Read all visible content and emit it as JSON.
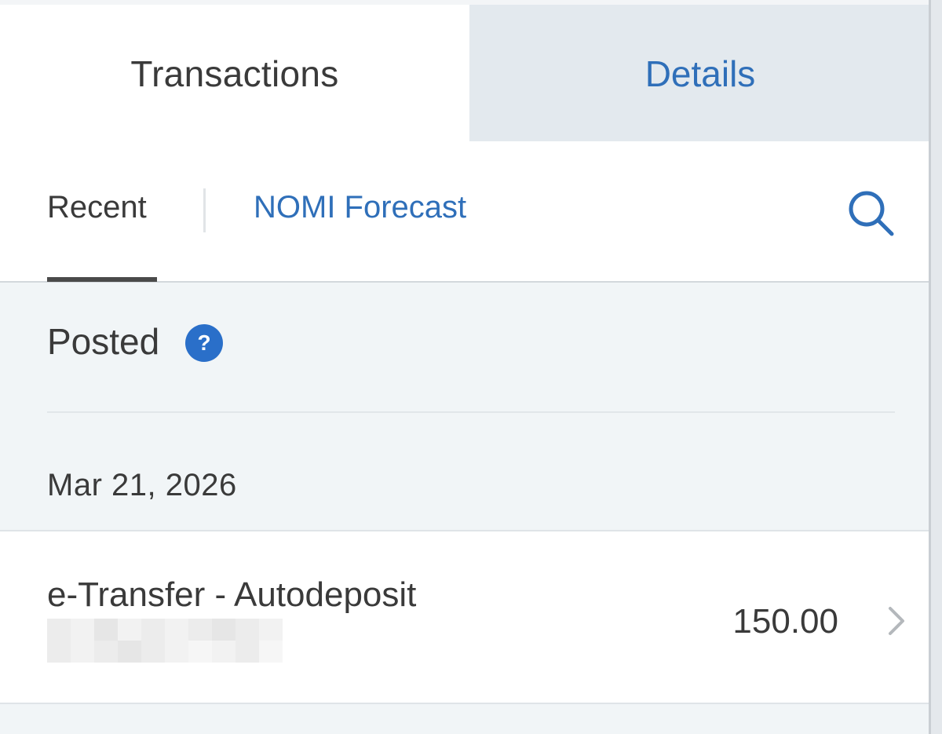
{
  "tabs": {
    "transactions_label": "Transactions",
    "details_label": "Details"
  },
  "subnav": {
    "recent_label": "Recent",
    "nomi_label": "NOMI Forecast",
    "search_icon": "search-icon"
  },
  "posted": {
    "title": "Posted",
    "help_icon_glyph": "?"
  },
  "transactions": {
    "date": "Mar 21, 2026",
    "items": [
      {
        "description": "e-Transfer - Autodeposit",
        "amount": "150.00",
        "chevron_icon": "chevron-right-icon"
      }
    ]
  },
  "colors": {
    "accent_blue": "#2f6fb9",
    "help_blue": "#2a6fc9",
    "text_dark": "#3a3a3a",
    "section_bg": "#f1f5f7",
    "inactive_tab_bg": "#e3e9ee"
  }
}
